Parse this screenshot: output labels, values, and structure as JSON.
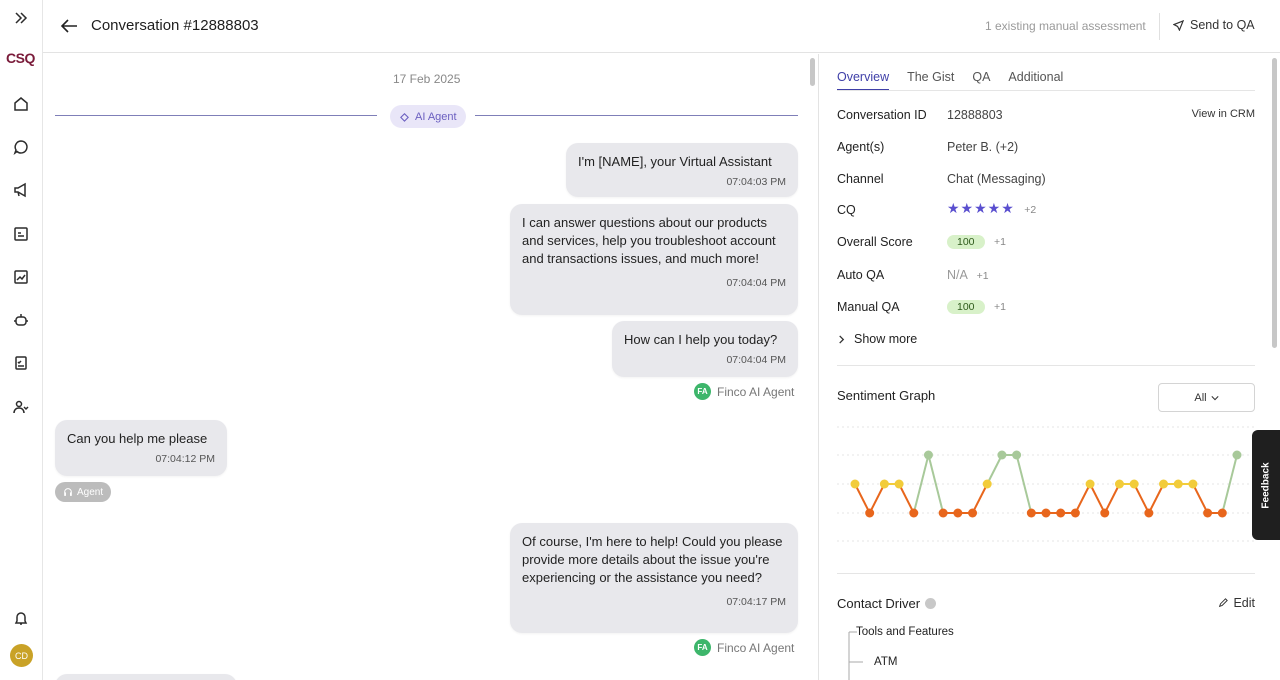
{
  "sidebar": {
    "logo": "CSQ",
    "user_initials": "CD",
    "icons": [
      "expand-icon",
      "home-icon",
      "chat-icon",
      "megaphone-icon",
      "clipboard-star-icon",
      "analytics-icon",
      "bot-icon",
      "checklist-icon",
      "team-icon",
      "bell-icon"
    ]
  },
  "header": {
    "title": "Conversation #12888803",
    "existing_assessment": "1 existing manual assessment",
    "send_to_qa": "Send to QA"
  },
  "chat": {
    "date": "17 Feb 2025",
    "divider_label": "AI Agent",
    "messages": [
      {
        "text": "I'm [NAME], your Virtual Assistant",
        "time": "07:04:03 PM"
      },
      {
        "text": "I can answer questions about our products and services, help you troubleshoot account and transactions issues, and much more!",
        "time": "07:04:04 PM"
      },
      {
        "text": "How can I help you today?",
        "time": "07:04:04 PM"
      },
      {
        "text": "Can you help me please",
        "time": "07:04:12 PM"
      },
      {
        "text": "Of course, I'm here to help! Could you please provide more details about the issue you're experiencing or the assistance you need?",
        "time": "07:04:17 PM"
      }
    ],
    "sender_initials": "FA",
    "sender_name": "Finco AI Agent",
    "customer_tag": "Agent"
  },
  "panel": {
    "tabs": [
      "Overview",
      "The Gist",
      "QA",
      "Additional"
    ],
    "view_in_crm": "View in CRM",
    "fields": {
      "conversation_id_label": "Conversation ID",
      "conversation_id": "12888803",
      "agents_label": "Agent(s)",
      "agents": "Peter B. (+2)",
      "channel_label": "Channel",
      "channel": "Chat (Messaging)",
      "cq_label": "CQ",
      "cq_stars": "★★★★★",
      "cq_extra": "+2",
      "overall_label": "Overall Score",
      "overall_score": "100",
      "overall_extra": "+1",
      "autoqa_label": "Auto QA",
      "autoqa": "N/A",
      "autoqa_extra": "+1",
      "manualqa_label": "Manual QA",
      "manualqa": "100",
      "manualqa_extra": "+1"
    },
    "show_more": "Show more",
    "sentiment_title": "Sentiment Graph",
    "sentiment_filter": "All",
    "contact_driver_title": "Contact Driver",
    "edit": "Edit",
    "tree_level1": "Tools and Features",
    "tree_level2": "ATM"
  },
  "chart_data": {
    "type": "line",
    "levels": {
      "positive": 3,
      "neutral": 2,
      "negative": 1
    },
    "values": [
      2,
      1,
      2,
      2,
      1,
      3,
      1,
      1,
      1,
      2,
      3,
      3,
      1,
      1,
      1,
      1,
      2,
      1,
      2,
      2,
      1,
      2,
      2,
      2,
      1,
      1,
      3
    ],
    "colors": {
      "positive": "#a8c99a",
      "neutral": "#f2cc3a",
      "negative": "#e8661c"
    }
  },
  "feedback": "Feedback"
}
